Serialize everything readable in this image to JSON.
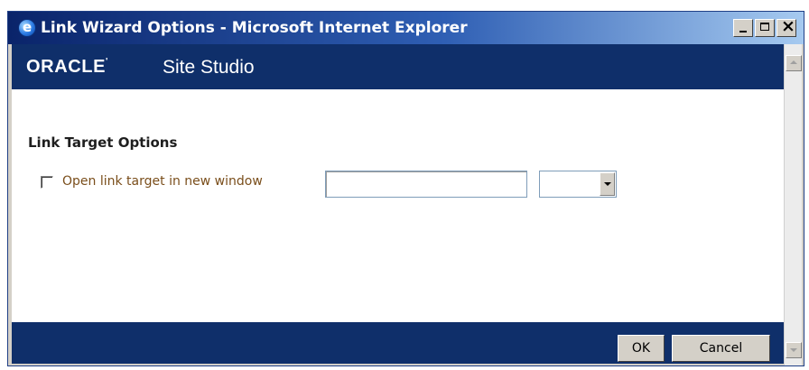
{
  "window": {
    "title": "Link Wizard Options - Microsoft Internet Explorer",
    "icon": "ie-icon",
    "controls": [
      "minimize-icon",
      "maximize-icon",
      "close-icon"
    ]
  },
  "header": {
    "brand": "ORACLE",
    "brand_mark": "'",
    "product": "Site Studio"
  },
  "main": {
    "section_title": "Link Target Options",
    "new_window_option": {
      "label": "Open link target in new window",
      "checked": false
    },
    "window_name_input": {
      "value": ""
    },
    "target_select": {
      "selected": ""
    }
  },
  "footer": {
    "ok_label": "OK",
    "cancel_label": "Cancel"
  }
}
